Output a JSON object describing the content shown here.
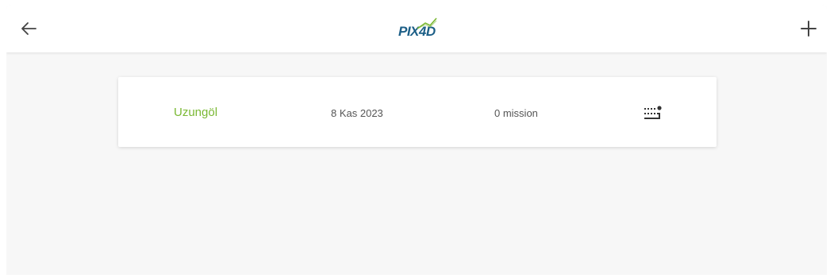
{
  "header": {
    "logo_text": "PIX4D",
    "back_icon": "arrow-left-icon",
    "add_icon": "plus-icon"
  },
  "projects": [
    {
      "name": "Uzungöl",
      "date": "8 Kas 2023",
      "missions": "0 mission",
      "action_icon": "dotted-grid-icon"
    }
  ],
  "colors": {
    "accent_green": "#7ab833",
    "brand_blue": "#1d5f87",
    "background": "#f7f7f7"
  }
}
